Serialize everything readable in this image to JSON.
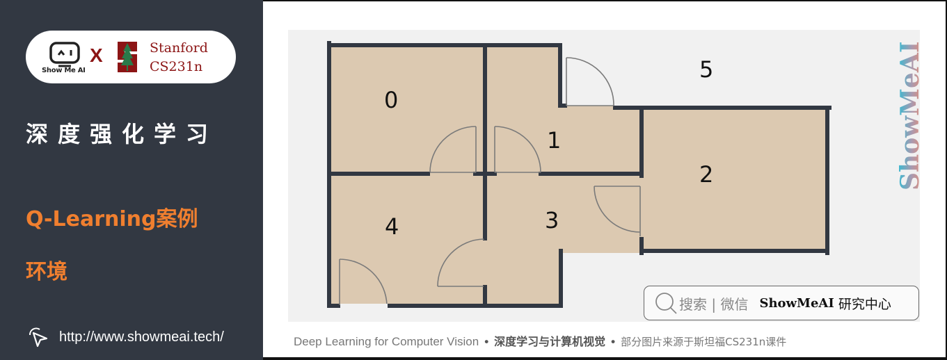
{
  "sidebar": {
    "logo": {
      "showmeai_label": "Show Me AI",
      "separator": "X",
      "stanford_line1": "Stanford",
      "stanford_line2": "CS231n"
    },
    "title": "深度强化学习",
    "subtitle_1": "Q-Learning案例",
    "subtitle_2": "环境",
    "url": "http://www.showmeai.tech/"
  },
  "floor_plan": {
    "rooms": [
      {
        "id": "0",
        "label": "0"
      },
      {
        "id": "1",
        "label": "1"
      },
      {
        "id": "2",
        "label": "2"
      },
      {
        "id": "3",
        "label": "3"
      },
      {
        "id": "4",
        "label": "4"
      },
      {
        "id": "5",
        "label": "5"
      }
    ],
    "colors": {
      "room_fill": "#dcc9b1",
      "wall": "#323842",
      "outside": "#f1f1f1",
      "door": "#7a7a7a"
    }
  },
  "watermark": "ShowMeAI",
  "search_box": {
    "hint": "搜索 | 微信",
    "brand": "ShowMeAI",
    "brand_suffix": "研究中心"
  },
  "footer": {
    "part1": "Deep Learning for Computer Vision",
    "separator": "•",
    "part2": "深度学习与计算机视觉",
    "part3": "部分图片来源于斯坦福CS231n课件"
  },
  "colors": {
    "sidebar_bg": "#323842",
    "accent_orange": "#f07f2f",
    "stanford_red": "#8c1515"
  }
}
